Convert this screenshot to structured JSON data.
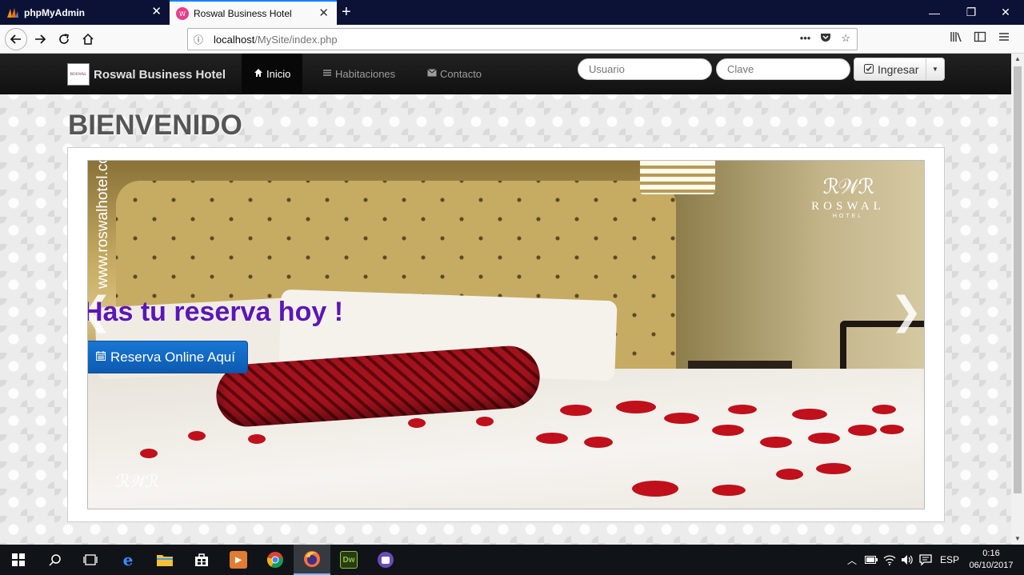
{
  "browser": {
    "tabs": [
      {
        "title": "phpMyAdmin",
        "active": false
      },
      {
        "title": "Roswal Business Hotel",
        "active": true
      }
    ],
    "url_host": "localhost",
    "url_path": "/MySite/index.php"
  },
  "site": {
    "brand": "Roswal Business Hotel",
    "brand_logo_text": "ROSWAL",
    "nav": [
      {
        "label": "Inicio",
        "icon": "home-icon",
        "active": true
      },
      {
        "label": "Habitaciones",
        "icon": "list-icon",
        "active": false
      },
      {
        "label": "Contacto",
        "icon": "envelope-icon",
        "active": false
      }
    ],
    "login": {
      "user_placeholder": "Usuario",
      "pass_placeholder": "Clave",
      "button_label": "Ingresar"
    },
    "welcome": "BIENVENIDO",
    "carousel": {
      "caption": "Has tu reserva hoy !",
      "button_label": "Reserva Online Aquí",
      "vertical_url": "www.roswalhotel.com",
      "watermark_word": "ROSWAL",
      "watermark_sub": "HOTEL",
      "prev_symbol": "❮",
      "next_symbol": "❯"
    }
  },
  "taskbar": {
    "language": "ESP",
    "time": "0:16",
    "date": "06/10/2017",
    "apps": [
      "start-icon",
      "search-icon",
      "task-view-icon",
      "edge-icon",
      "file-explorer-icon",
      "store-icon",
      "media-player-icon",
      "chrome-icon",
      "firefox-icon",
      "dreamweaver-icon",
      "app-icon"
    ]
  },
  "colors": {
    "tab_strip": "#0c1236",
    "accent_tab": "#0a84ff",
    "caption_purple": "#5b16b8",
    "button_blue": "#1877d4",
    "site_nav": "#1a1a1a"
  }
}
